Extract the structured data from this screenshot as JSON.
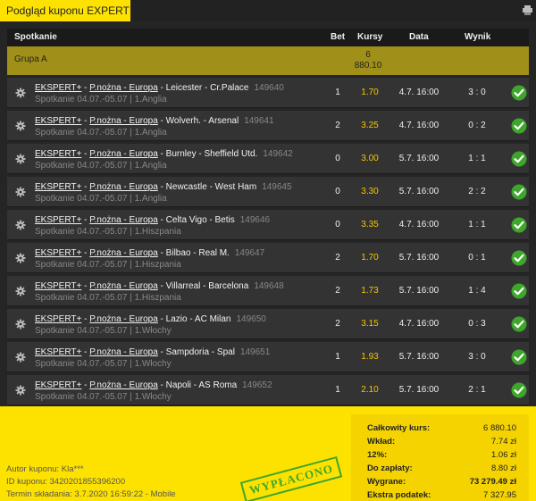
{
  "tab": {
    "title": "Podgląd kuponu EXPERT"
  },
  "icons": {
    "print": "print-icon",
    "gear": "gear-icon",
    "check": "check-icon"
  },
  "colors": {
    "accent": "#fde200",
    "odds": "#f4c700",
    "win": "#3fa62c"
  },
  "table": {
    "headers": {
      "match": "Spotkanie",
      "bet": "Bet",
      "odds": "Kursy",
      "date": "Data",
      "result": "Wynik"
    },
    "group": {
      "name": "Grupa A",
      "line1": "6",
      "line2": "880.10"
    },
    "rows": [
      {
        "prefix": "EKSPERT+",
        "sport": "P.nożna - Europa",
        "teams": "Leicester - Cr.Palace",
        "event_id": "149640",
        "meta": "Spotkanie 04.07.-05.07 | 1.Anglia",
        "bet": "1",
        "odds": "1.70",
        "date": "4.7. 16:00",
        "result": "3 : 0"
      },
      {
        "prefix": "EKSPERT+",
        "sport": "P.nożna - Europa",
        "teams": "Wolverh. - Arsenal",
        "event_id": "149641",
        "meta": "Spotkanie 04.07.-05.07 | 1.Anglia",
        "bet": "2",
        "odds": "3.25",
        "date": "4.7. 16:00",
        "result": "0 : 2"
      },
      {
        "prefix": "EKSPERT+",
        "sport": "P.nożna - Europa",
        "teams": "Burnley - Sheffield Utd.",
        "event_id": "149642",
        "meta": "Spotkanie 04.07.-05.07 | 1.Anglia",
        "bet": "0",
        "odds": "3.00",
        "date": "5.7. 16:00",
        "result": "1 : 1"
      },
      {
        "prefix": "EKSPERT+",
        "sport": "P.nożna - Europa",
        "teams": "Newcastle - West Ham",
        "event_id": "149645",
        "meta": "Spotkanie 04.07.-05.07 | 1.Anglia",
        "bet": "0",
        "odds": "3.30",
        "date": "5.7. 16:00",
        "result": "2 : 2"
      },
      {
        "prefix": "EKSPERT+",
        "sport": "P.nożna - Europa",
        "teams": "Celta Vigo - Betis",
        "event_id": "149646",
        "meta": "Spotkanie 04.07.-05.07 | 1.Hiszpania",
        "bet": "0",
        "odds": "3.35",
        "date": "4.7. 16:00",
        "result": "1 : 1"
      },
      {
        "prefix": "EKSPERT+",
        "sport": "P.nożna - Europa",
        "teams": "Bilbao - Real M.",
        "event_id": "149647",
        "meta": "Spotkanie 04.07.-05.07 | 1.Hiszpania",
        "bet": "2",
        "odds": "1.70",
        "date": "5.7. 16:00",
        "result": "0 : 1"
      },
      {
        "prefix": "EKSPERT+",
        "sport": "P.nożna - Europa",
        "teams": "Villarreal - Barcelona",
        "event_id": "149648",
        "meta": "Spotkanie 04.07.-05.07 | 1.Hiszpania",
        "bet": "2",
        "odds": "1.73",
        "date": "5.7. 16:00",
        "result": "1 : 4"
      },
      {
        "prefix": "EKSPERT+",
        "sport": "P.nożna - Europa",
        "teams": "Lazio - AC Milan",
        "event_id": "149650",
        "meta": "Spotkanie 04.07.-05.07 | 1.Włochy",
        "bet": "2",
        "odds": "3.15",
        "date": "4.7. 16:00",
        "result": "0 : 3"
      },
      {
        "prefix": "EKSPERT+",
        "sport": "P.nożna - Europa",
        "teams": "Sampdoria - Spal",
        "event_id": "149651",
        "meta": "Spotkanie 04.07.-05.07 | 1.Włochy",
        "bet": "1",
        "odds": "1.93",
        "date": "5.7. 16:00",
        "result": "3 : 0"
      },
      {
        "prefix": "EKSPERT+",
        "sport": "P.nożna - Europa",
        "teams": "Napoli - AS Roma",
        "event_id": "149652",
        "meta": "Spotkanie 04.07.-05.07 | 1.Włochy",
        "bet": "1",
        "odds": "2.10",
        "date": "5.7. 16:00",
        "result": "2 : 1"
      }
    ]
  },
  "footer": {
    "author": "Autor kuponu: Kla***",
    "coupon_id": "ID kuponu: 3420201855396200",
    "submitted": "Termin składania: 3.7.2020 16:59:22 - Mobile",
    "stamp": "WYPŁACONO"
  },
  "summary": {
    "rows": [
      {
        "label": "Całkowity kurs:",
        "value": "6 880.10"
      },
      {
        "label": "Wkład:",
        "value": "7.74 zł"
      },
      {
        "label": "12%:",
        "value": "1.06 zł"
      },
      {
        "label": "Do zapłaty:",
        "value": "8.80 zł"
      },
      {
        "label": "Wygrane:",
        "value": "73 279.49 zł"
      },
      {
        "label": "Ekstra podatek:",
        "value": "7 327.95"
      }
    ]
  }
}
